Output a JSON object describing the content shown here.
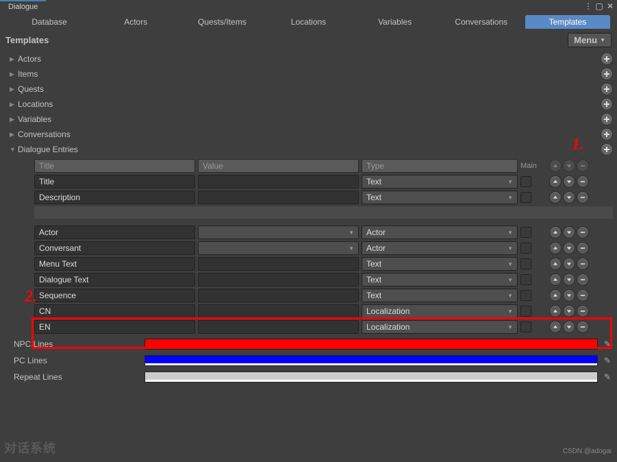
{
  "window": {
    "title": "Dialogue"
  },
  "tabs": [
    "Database",
    "Actors",
    "Quests/Items",
    "Locations",
    "Variables",
    "Conversations",
    "Templates"
  ],
  "active_tab": "Templates",
  "section": {
    "title": "Templates",
    "menu_label": "Menu"
  },
  "tree": [
    {
      "label": "Actors",
      "expanded": false
    },
    {
      "label": "Items",
      "expanded": false
    },
    {
      "label": "Quests",
      "expanded": false
    },
    {
      "label": "Locations",
      "expanded": false
    },
    {
      "label": "Variables",
      "expanded": false
    },
    {
      "label": "Conversations",
      "expanded": false
    },
    {
      "label": "Dialogue Entries",
      "expanded": true
    }
  ],
  "headers": {
    "title": "Title",
    "value": "Value",
    "type": "Type",
    "main": "Main"
  },
  "rows_a": [
    {
      "title": "Title",
      "value": "",
      "type": "Text"
    },
    {
      "title": "Description",
      "value": "",
      "type": "Text"
    }
  ],
  "rows_b": [
    {
      "title": "Actor",
      "value_select": "",
      "type": "Actor"
    },
    {
      "title": "Conversant",
      "value_select": "",
      "type": "Actor"
    },
    {
      "title": "Menu Text",
      "value": "",
      "type": "Text"
    },
    {
      "title": "Dialogue Text",
      "value": "",
      "type": "Text"
    },
    {
      "title": "Sequence",
      "value": "",
      "type": "Text"
    },
    {
      "title": "CN",
      "value": "",
      "type": "Localization"
    },
    {
      "title": "EN",
      "value": "",
      "type": "Localization"
    }
  ],
  "color_rows": [
    {
      "label": "NPC Lines",
      "color": "#ff0000"
    },
    {
      "label": "PC Lines",
      "color": "#0000ff"
    },
    {
      "label": "Repeat Lines",
      "color": "#cccccc"
    }
  ],
  "annotations": {
    "one": "1.",
    "two": "2."
  },
  "watermark": "对话系统",
  "credit": "CSDN @adogai"
}
